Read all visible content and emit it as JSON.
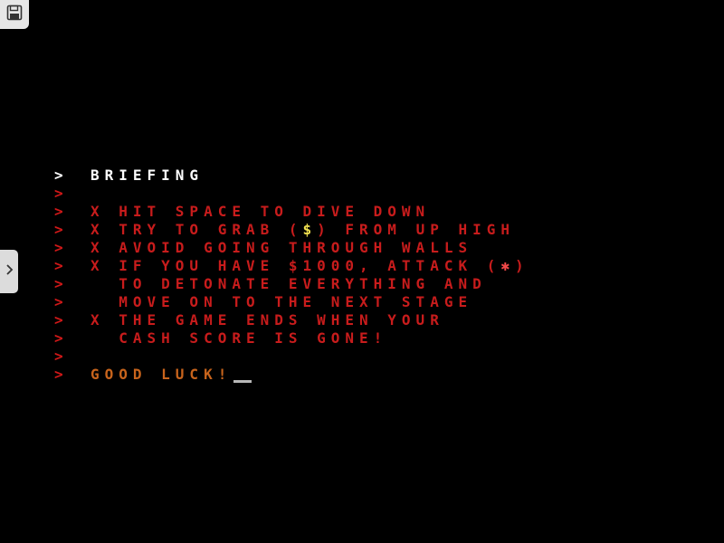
{
  "ui": {
    "save_icon": "floppy-disk-icon",
    "drawer_icon": "chevron-right-icon"
  },
  "colors": {
    "background": "#000000",
    "text_red": "#c81c1c",
    "text_white": "#ffffff",
    "text_orange": "#c8641c",
    "cursor": "#b8b8b8"
  },
  "terminal": {
    "prompt": ">",
    "lines": {
      "title": "BRIEFING",
      "blank1": "",
      "l1": "X HIT SPACE TO DIVE DOWN",
      "l2_before": "X TRY TO GRAB (",
      "l2_symbol": "$",
      "l2_after": ") FROM UP HIGH",
      "l3": "X AVOID GOING THROUGH WALLS",
      "l4_before": "X IF YOU HAVE $1000, ATTACK (",
      "l4_symbol": "✱",
      "l4_after": ")",
      "l5": "  TO DETONATE EVERYTHING AND",
      "l6": "  MOVE ON TO THE NEXT STAGE",
      "l7": "X THE GAME ENDS WHEN YOUR",
      "l8": "  CASH SCORE IS GONE!",
      "blank2": "",
      "closing": "GOOD LUCK!"
    }
  }
}
